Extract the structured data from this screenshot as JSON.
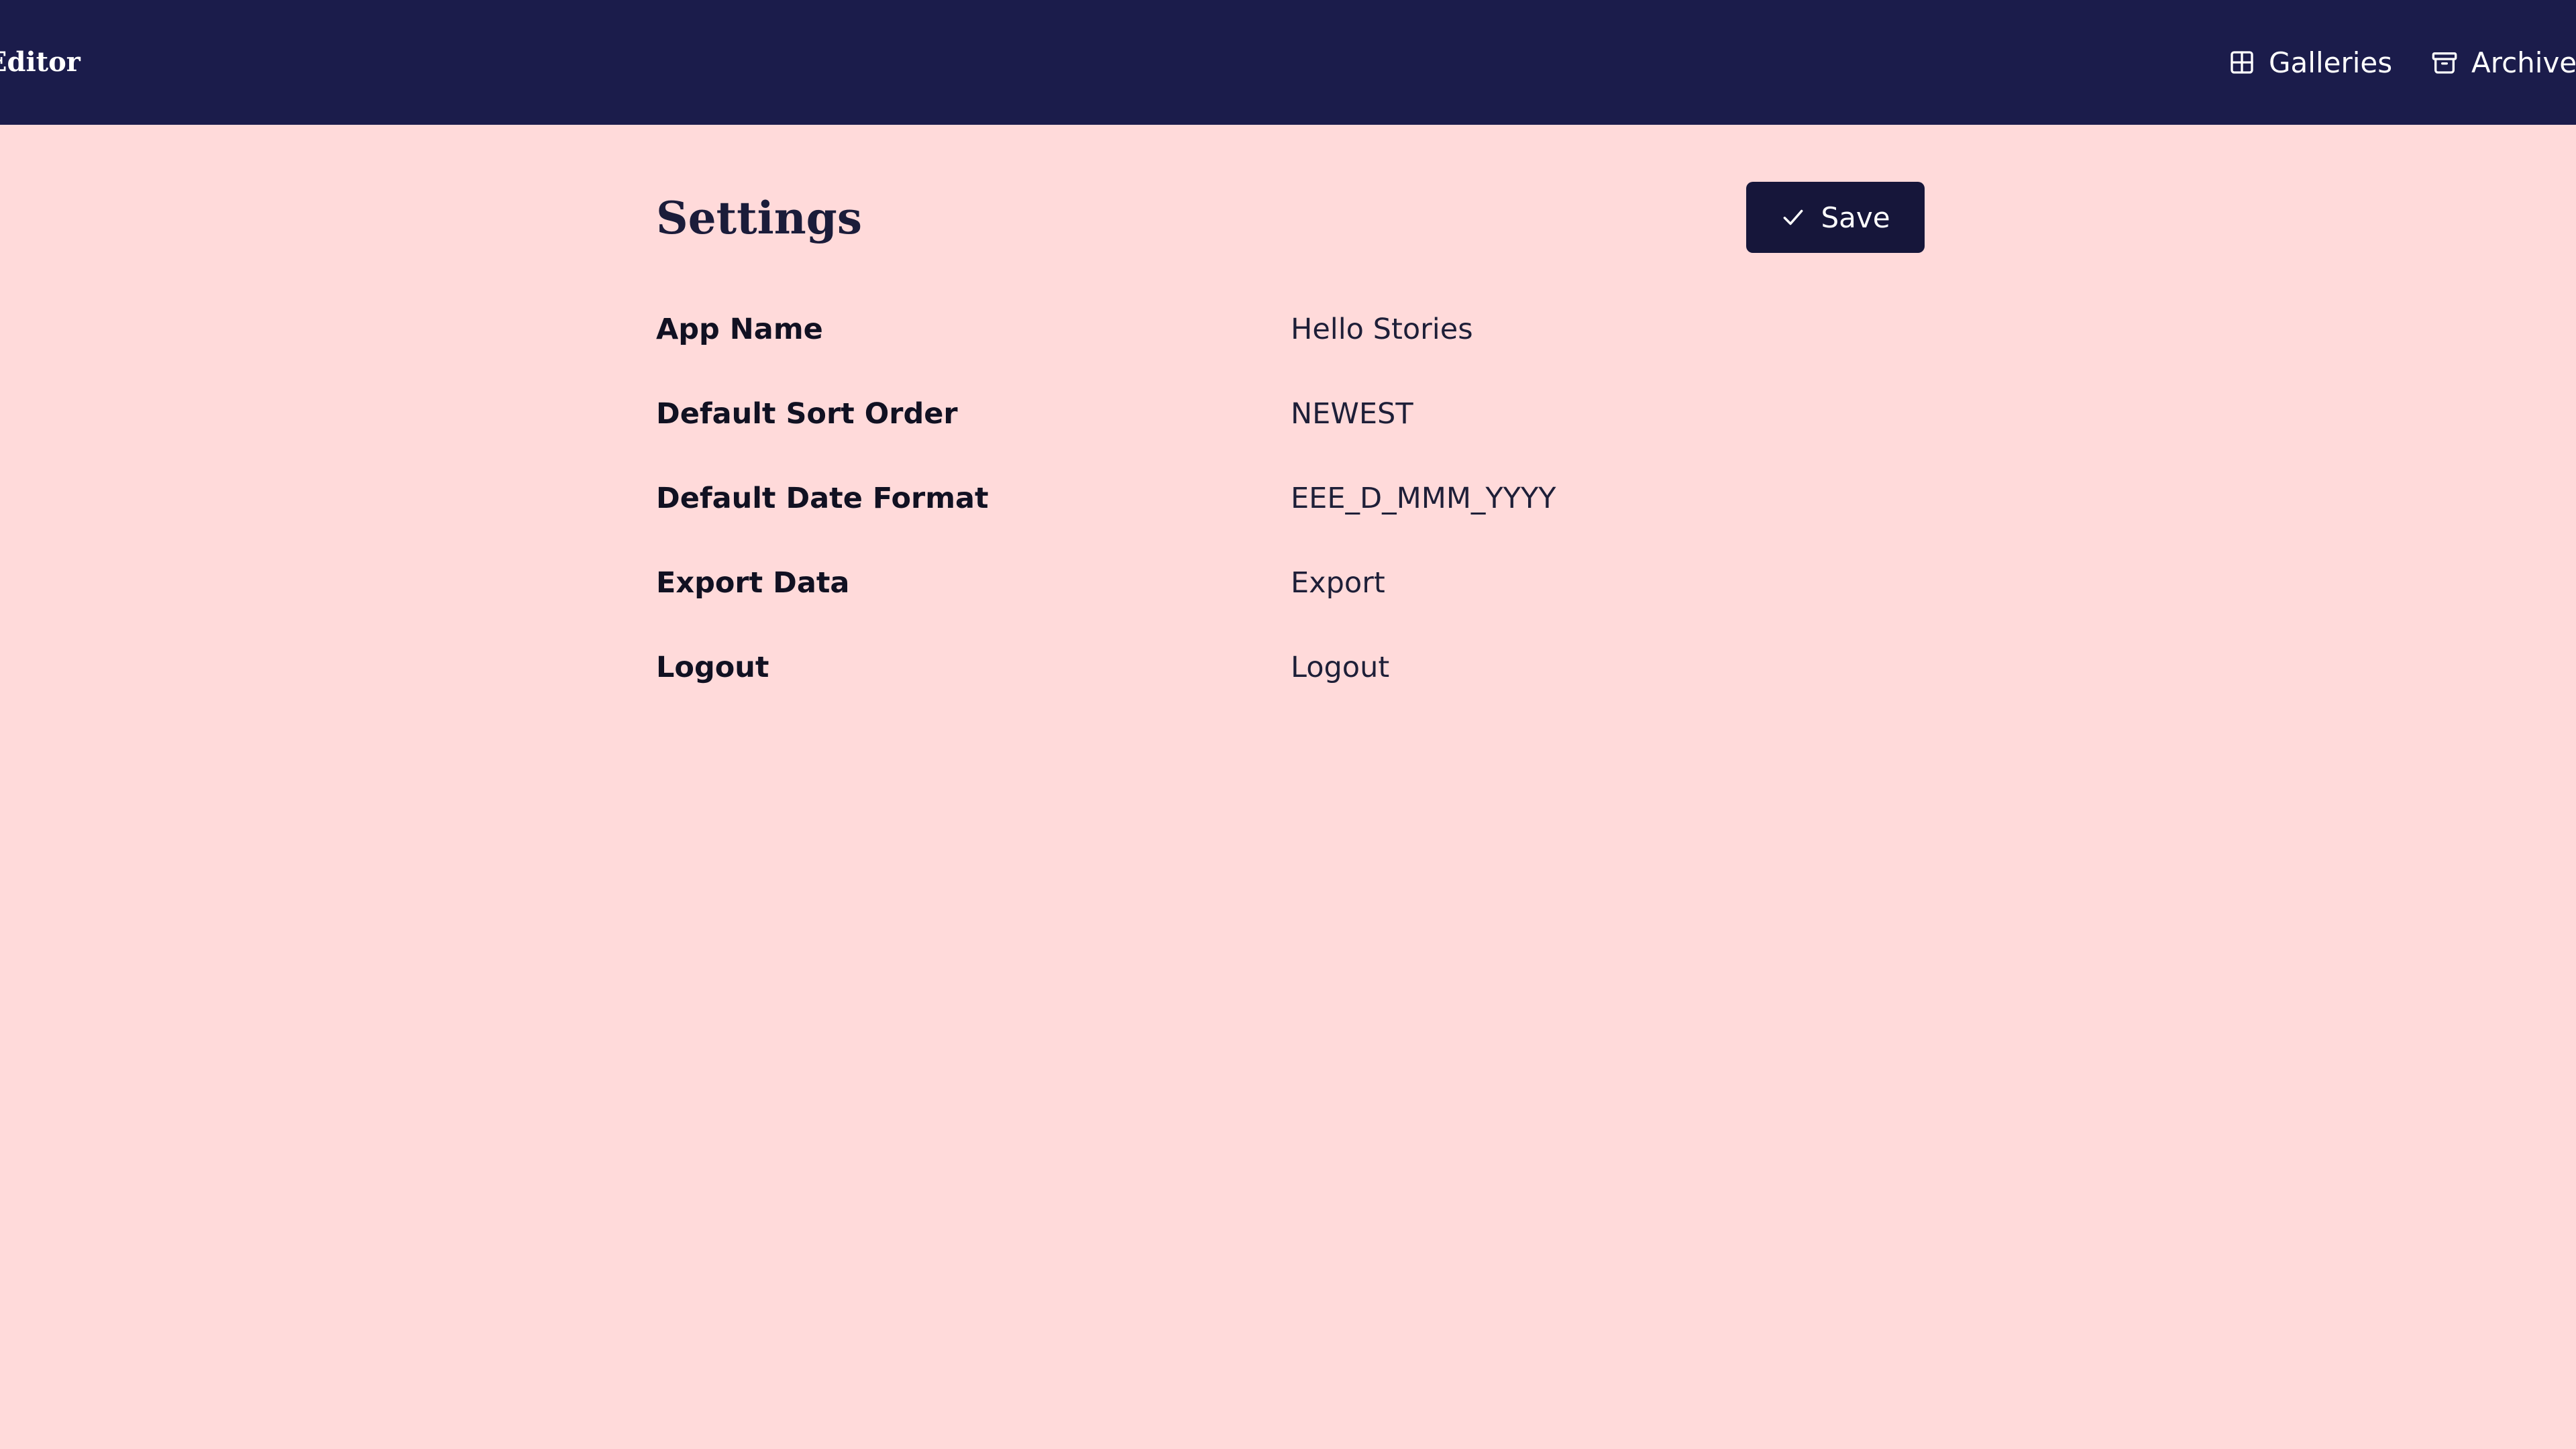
{
  "header": {
    "brand": "Editor",
    "nav": [
      {
        "label": "Galleries",
        "icon": "grid-icon"
      },
      {
        "label": "Archive",
        "icon": "archive-icon"
      }
    ]
  },
  "page": {
    "title": "Settings",
    "save_label": "Save"
  },
  "settings": [
    {
      "label": "App Name",
      "value": "Hello Stories"
    },
    {
      "label": "Default Sort Order",
      "value": "NEWEST"
    },
    {
      "label": "Default Date Format",
      "value": "EEE_D_MMM_YYYY"
    },
    {
      "label": "Export Data",
      "value": "Export"
    },
    {
      "label": "Logout",
      "value": "Logout"
    }
  ],
  "colors": {
    "header_bg": "#1b1c4b",
    "page_bg": "#ffdada",
    "button_bg": "#16163a"
  }
}
